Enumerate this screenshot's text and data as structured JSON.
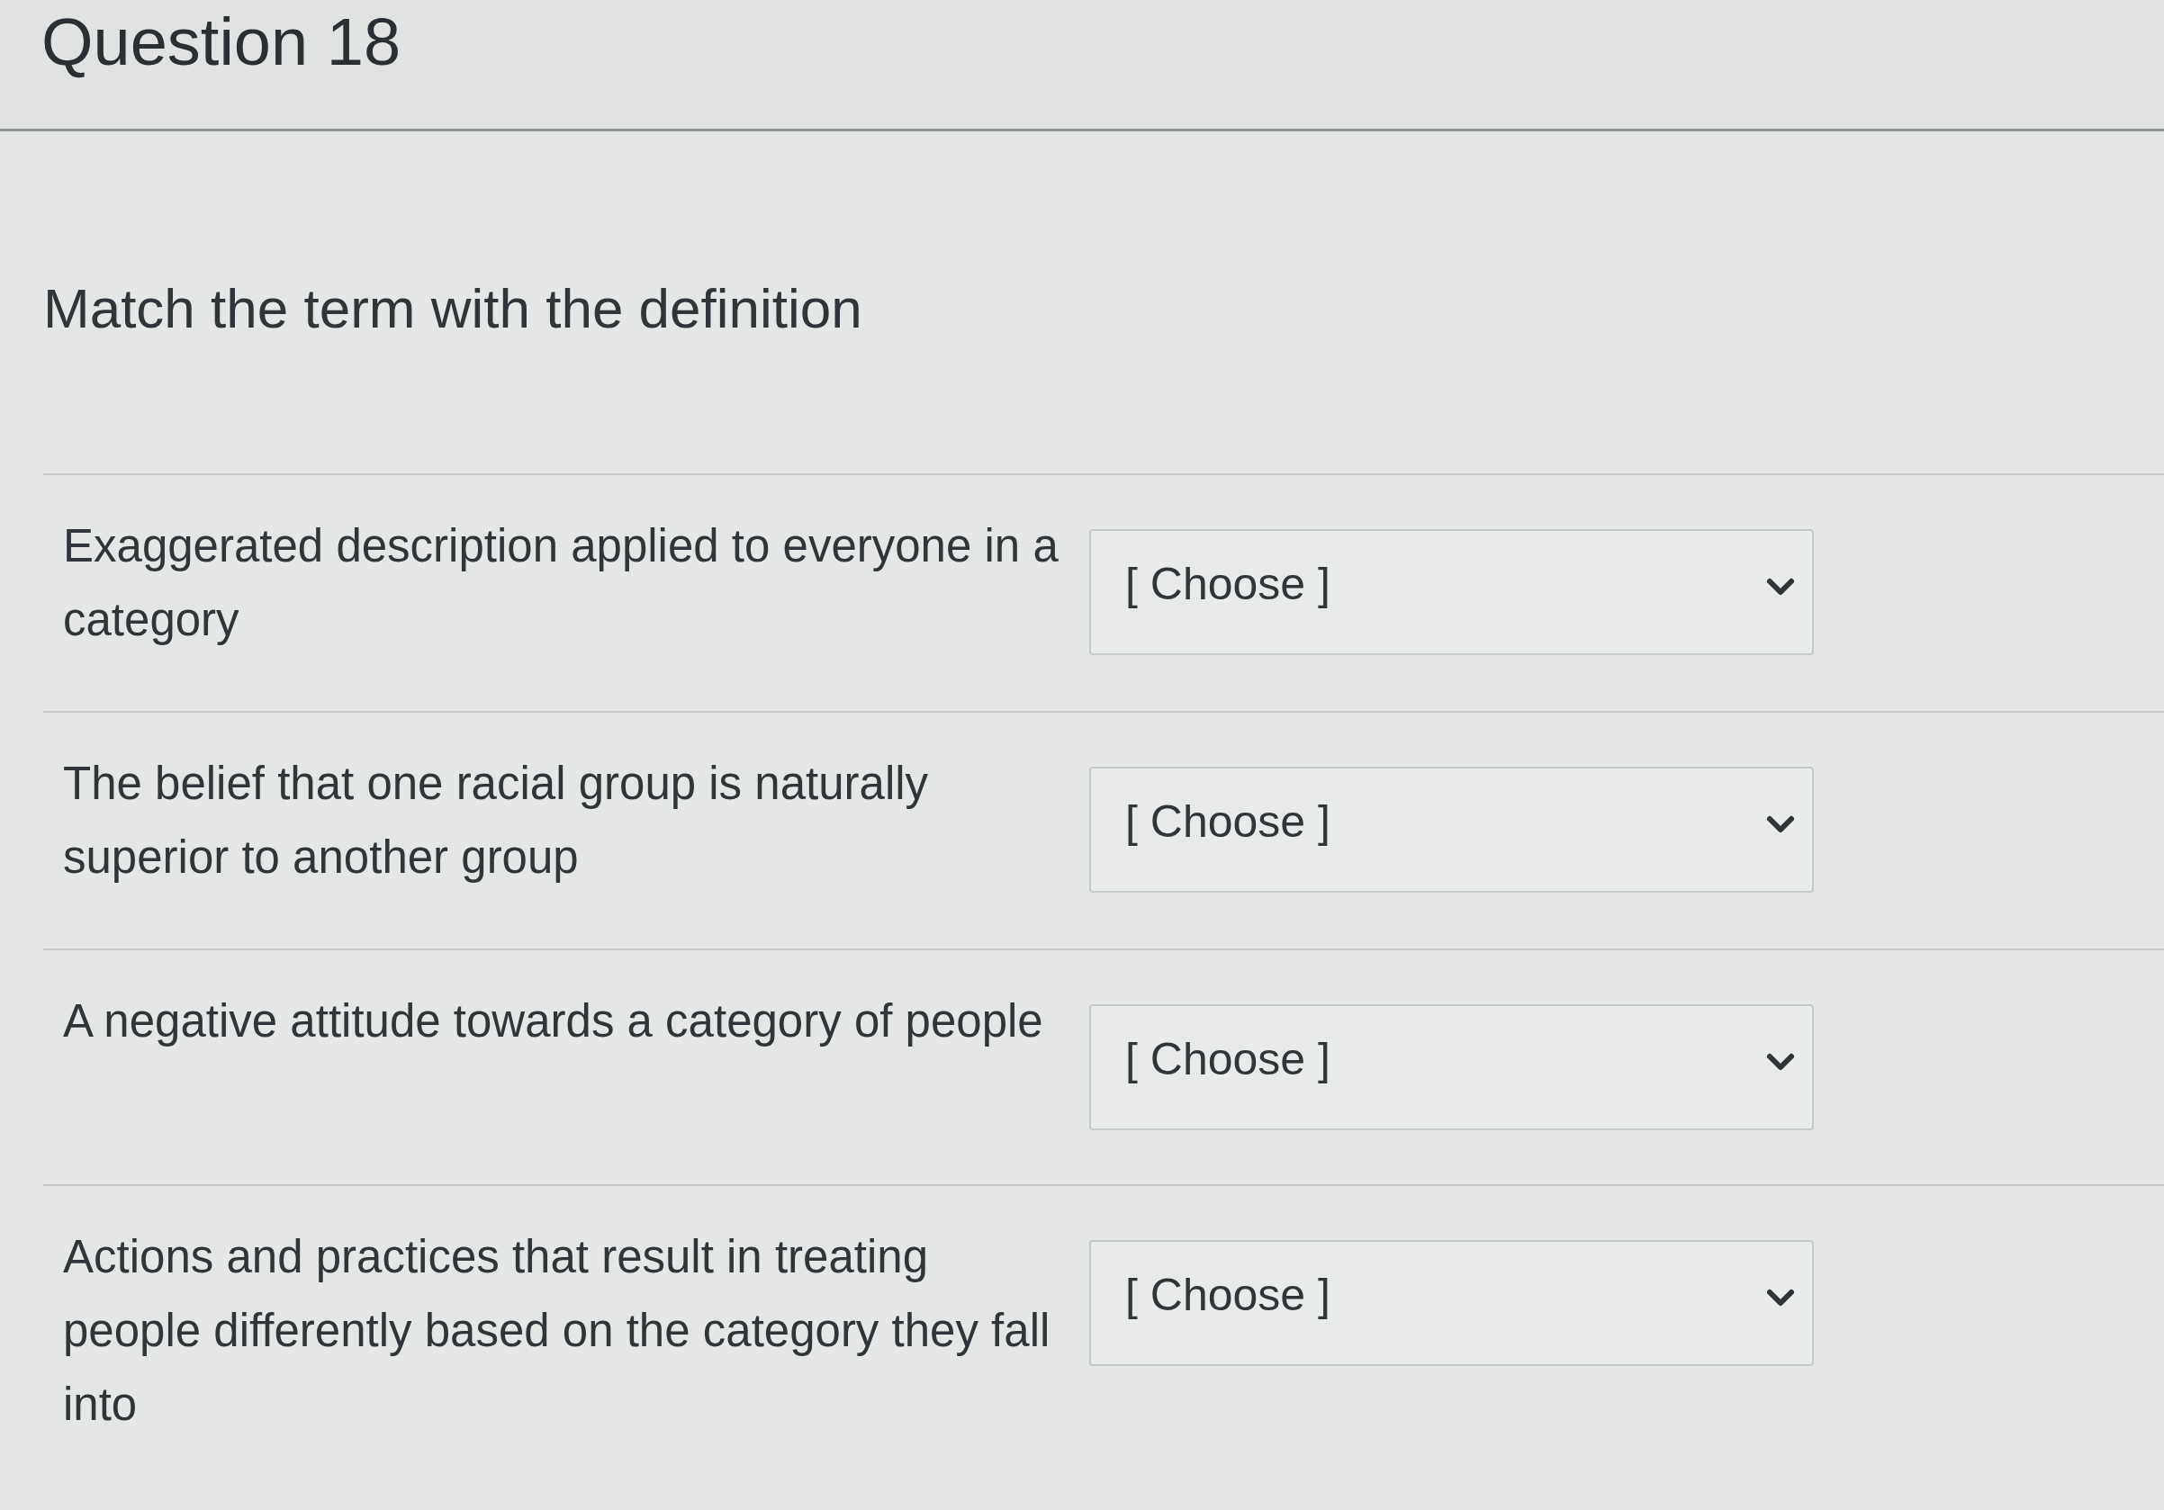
{
  "question": {
    "title": "Question 18",
    "prompt": "Match the term with the definition"
  },
  "matches": [
    {
      "term": "Exaggerated description applied to everyone in a category",
      "selection": "[ Choose ]"
    },
    {
      "term": "The belief that one racial group is naturally superior to another group",
      "selection": "[ Choose ]"
    },
    {
      "term": "A negative attitude towards a category of people",
      "selection": "[ Choose ]"
    },
    {
      "term": "Actions and practices that result in treating people differently based on the category they fall into",
      "selection": "[ Choose ]"
    }
  ]
}
